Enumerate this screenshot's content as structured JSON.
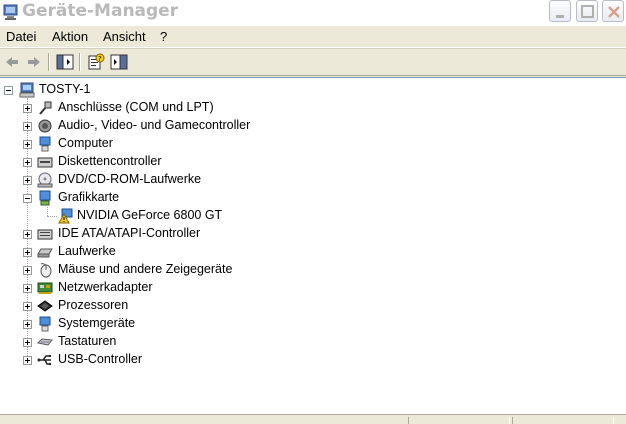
{
  "window": {
    "title": "Geräte-Manager"
  },
  "menu": {
    "items": [
      "Datei",
      "Aktion",
      "Ansicht",
      "?"
    ]
  },
  "toolbar": {
    "icons": [
      "back-arrow-icon",
      "forward-arrow-icon",
      "show-hide-tree-icon",
      "properties-help-icon",
      "show-hide-pane-icon"
    ]
  },
  "tree": {
    "root": "TOSTY-1",
    "categories": [
      {
        "label": "Anschlüsse (COM und LPT)",
        "icon": "port-icon",
        "expanded": false
      },
      {
        "label": "Audio-, Video- und Gamecontroller",
        "icon": "speaker-icon",
        "expanded": false
      },
      {
        "label": "Computer",
        "icon": "computer-icon",
        "expanded": false
      },
      {
        "label": "Diskettencontroller",
        "icon": "floppy-controller-icon",
        "expanded": false
      },
      {
        "label": "DVD/CD-ROM-Laufwerke",
        "icon": "cdrom-icon",
        "expanded": false
      },
      {
        "label": "Grafikkarte",
        "icon": "display-adapter-icon",
        "expanded": true,
        "children": [
          {
            "label": "NVIDIA GeForce 6800 GT",
            "icon": "warning-device-icon"
          }
        ]
      },
      {
        "label": "IDE ATA/ATAPI-Controller",
        "icon": "ide-controller-icon",
        "expanded": false
      },
      {
        "label": "Laufwerke",
        "icon": "drive-icon",
        "expanded": false
      },
      {
        "label": "Mäuse und andere Zeigegeräte",
        "icon": "mouse-icon",
        "expanded": false
      },
      {
        "label": "Netzwerkadapter",
        "icon": "network-adapter-icon",
        "expanded": false
      },
      {
        "label": "Prozessoren",
        "icon": "processor-icon",
        "expanded": false
      },
      {
        "label": "Systemgeräte",
        "icon": "system-device-icon",
        "expanded": false
      },
      {
        "label": "Tastaturen",
        "icon": "keyboard-icon",
        "expanded": false
      },
      {
        "label": "USB-Controller",
        "icon": "usb-icon",
        "expanded": false
      }
    ]
  }
}
